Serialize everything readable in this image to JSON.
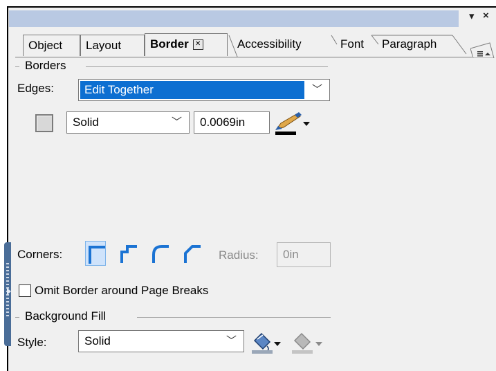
{
  "window": {
    "pin_glyph": "▾",
    "close_glyph": "×"
  },
  "tabs": [
    {
      "label": "Object",
      "active": false
    },
    {
      "label": "Layout",
      "active": false
    },
    {
      "label": "Border",
      "active": true
    },
    {
      "label": "Accessibility",
      "active": false
    },
    {
      "label": "Font",
      "active": false
    },
    {
      "label": "Paragraph",
      "active": false
    }
  ],
  "tab_close_glyph": "✕",
  "borders": {
    "section_label": "Borders",
    "edges_label": "Edges:",
    "edges_value": "Edit Together",
    "line_style": "Solid",
    "line_width": "0.0069in"
  },
  "corners": {
    "label": "Corners:",
    "radius_label": "Radius:",
    "radius_value": "0in"
  },
  "omit_border": {
    "label": "Omit Border around Page Breaks",
    "checked": false
  },
  "background": {
    "section_label": "Background Fill",
    "style_label": "Style:",
    "style_value": "Solid"
  },
  "colors": {
    "selection": "#0d6fd1",
    "corner_blue": "#1b73d3",
    "titlebar": "#b9c9e3"
  }
}
